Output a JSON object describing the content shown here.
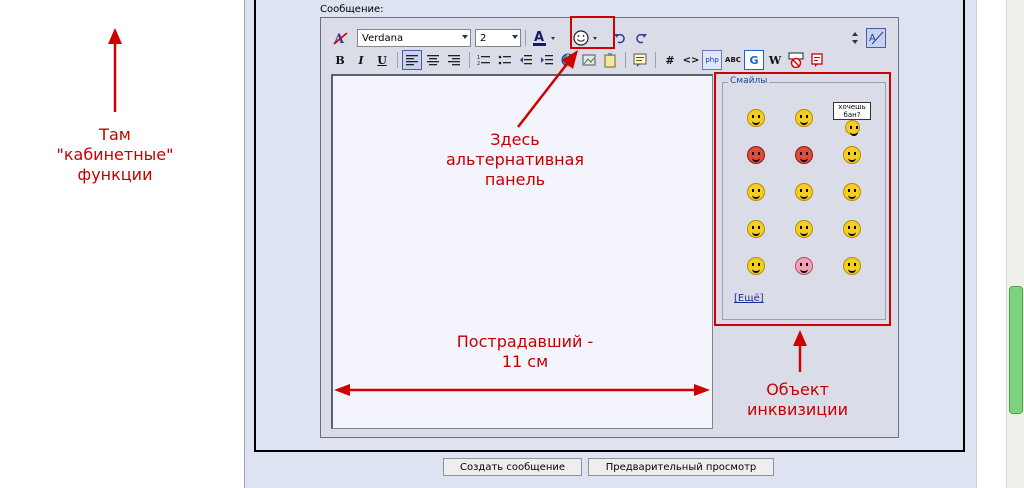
{
  "editor": {
    "message_label": "Сообщение:",
    "font_name": "Verdana",
    "font_size": "2"
  },
  "toolbar": {
    "bold": "B",
    "italic": "I",
    "underline": "U",
    "hash": "#",
    "code": "<>",
    "php": "php",
    "abc": "ABC",
    "g": "G",
    "w": "W"
  },
  "smilies": {
    "legend": "Смайлы",
    "more": "[Ещё]",
    "sign_text": "хочешь бан?"
  },
  "buttons": {
    "submit": "Создать сообщение",
    "preview": "Предварительный просмотр"
  },
  "annotations": {
    "left": [
      "Там",
      "\"кабинетные\"",
      "функции"
    ],
    "middle": [
      "Здесь",
      "альтернативная",
      "панель"
    ],
    "width": [
      "Пострадавший -",
      "11 см"
    ],
    "right": [
      "Объект",
      "инквизиции"
    ]
  },
  "colors": {
    "annotation_red": "#c40000",
    "link_blue": "#1c2f9c"
  }
}
